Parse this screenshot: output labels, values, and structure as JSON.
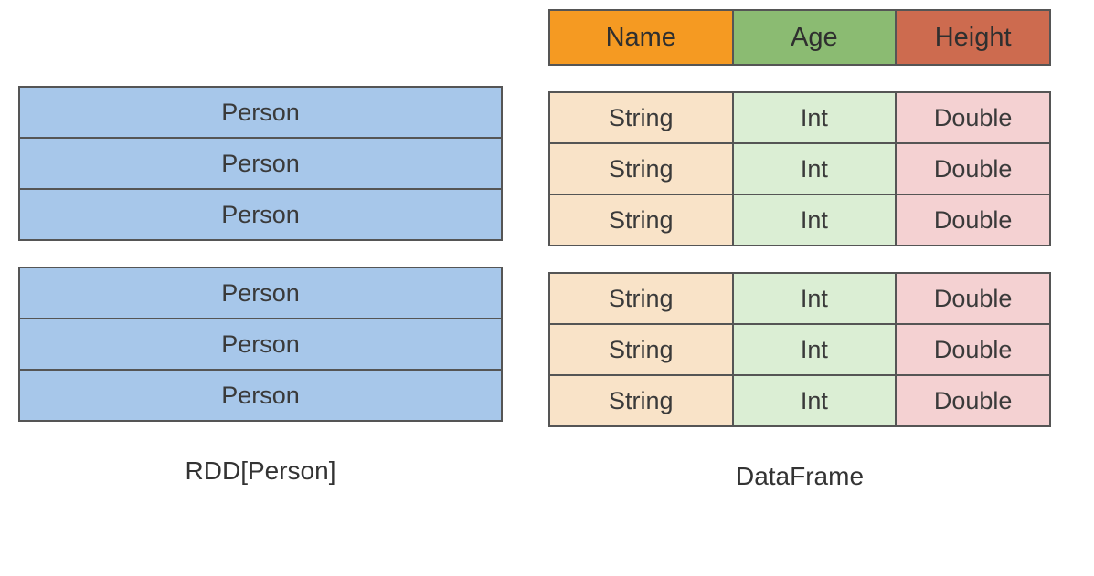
{
  "rdd": {
    "caption": "RDD[Person]",
    "row_label": "Person",
    "blocks": [
      3,
      3
    ]
  },
  "df": {
    "caption": "DataFrame",
    "headers": {
      "name": "Name",
      "age": "Age",
      "height": "Height"
    },
    "types": {
      "name": "String",
      "age": "Int",
      "height": "Double"
    },
    "blocks": [
      3,
      3
    ]
  }
}
